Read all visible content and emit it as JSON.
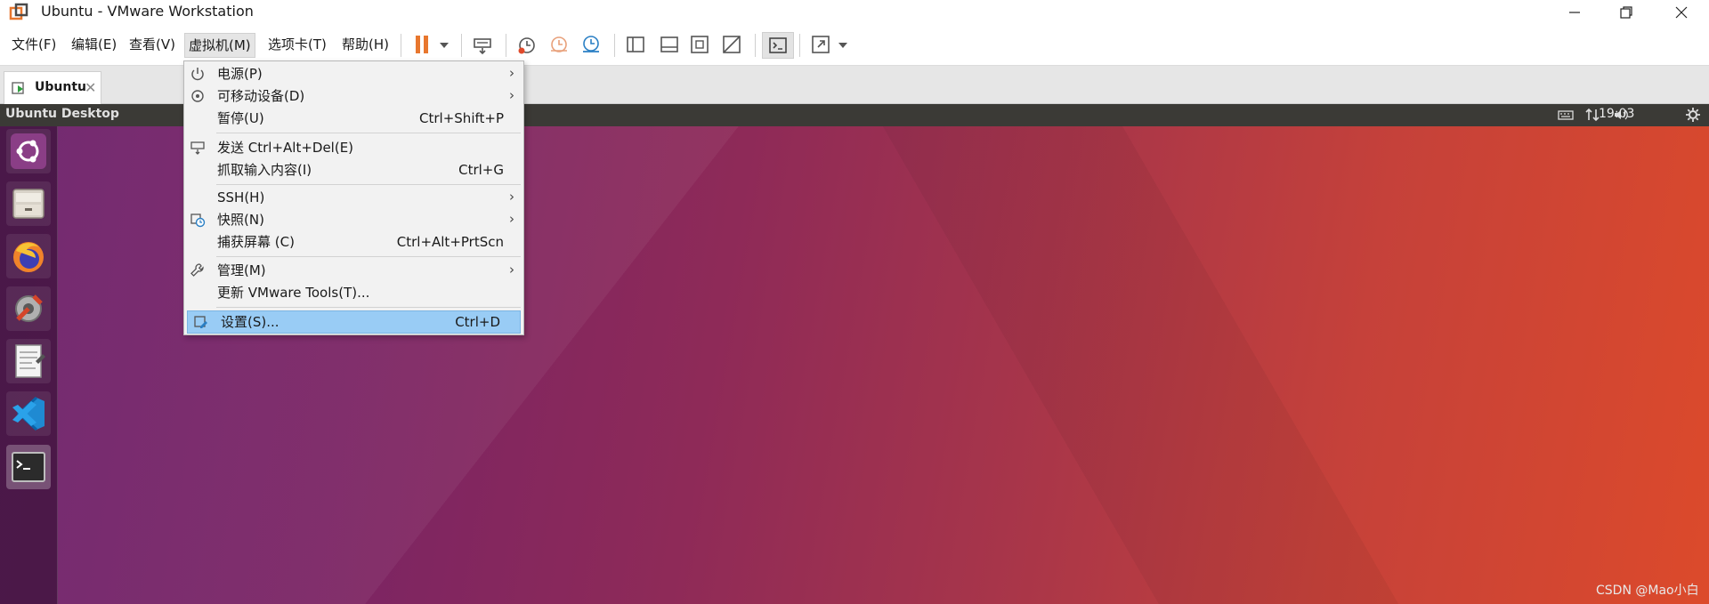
{
  "window": {
    "title": "Ubuntu - VMware Workstation"
  },
  "menubar": {
    "items": [
      "文件(F)",
      "编辑(E)",
      "查看(V)",
      "虚拟机(M)",
      "选项卡(T)",
      "帮助(H)"
    ],
    "active_index": 3
  },
  "tab": {
    "label": "Ubuntu",
    "close": "✕"
  },
  "vm": {
    "topbar_title": "Ubuntu Desktop",
    "clock": "19:03",
    "watermark": "CSDN @Mao小白"
  },
  "vm_menu": {
    "items": [
      {
        "label": "电源(P)",
        "shortcut": "",
        "submenu": true,
        "icon": "power-icon"
      },
      {
        "label": "可移动设备(D)",
        "shortcut": "",
        "submenu": true,
        "icon": "removable-device-icon"
      },
      {
        "label": "暂停(U)",
        "shortcut": "Ctrl+Shift+P",
        "submenu": false,
        "icon": ""
      },
      {
        "label": "发送 Ctrl+Alt+Del(E)",
        "shortcut": "",
        "submenu": false,
        "icon": "send-keys-icon"
      },
      {
        "label": "抓取输入内容(I)",
        "shortcut": "Ctrl+G",
        "submenu": false,
        "icon": ""
      },
      {
        "label": "SSH(H)",
        "shortcut": "",
        "submenu": true,
        "icon": ""
      },
      {
        "label": "快照(N)",
        "shortcut": "",
        "submenu": true,
        "icon": "snapshot-icon"
      },
      {
        "label": "捕获屏幕 (C)",
        "shortcut": "Ctrl+Alt+PrtScn",
        "submenu": false,
        "icon": ""
      },
      {
        "label": "管理(M)",
        "shortcut": "",
        "submenu": true,
        "icon": "wrench-icon"
      },
      {
        "label": "更新 VMware Tools(T)...",
        "shortcut": "",
        "submenu": false,
        "icon": ""
      },
      {
        "label": "设置(S)...",
        "shortcut": "Ctrl+D",
        "submenu": false,
        "icon": "settings-icon",
        "highlighted": true
      }
    ],
    "submenu_arrow": "›"
  },
  "colors": {
    "menu_highlight": "#99ccf5",
    "pause_orange": "#e8772e",
    "ubuntu_topbar": "#3b3a36"
  }
}
